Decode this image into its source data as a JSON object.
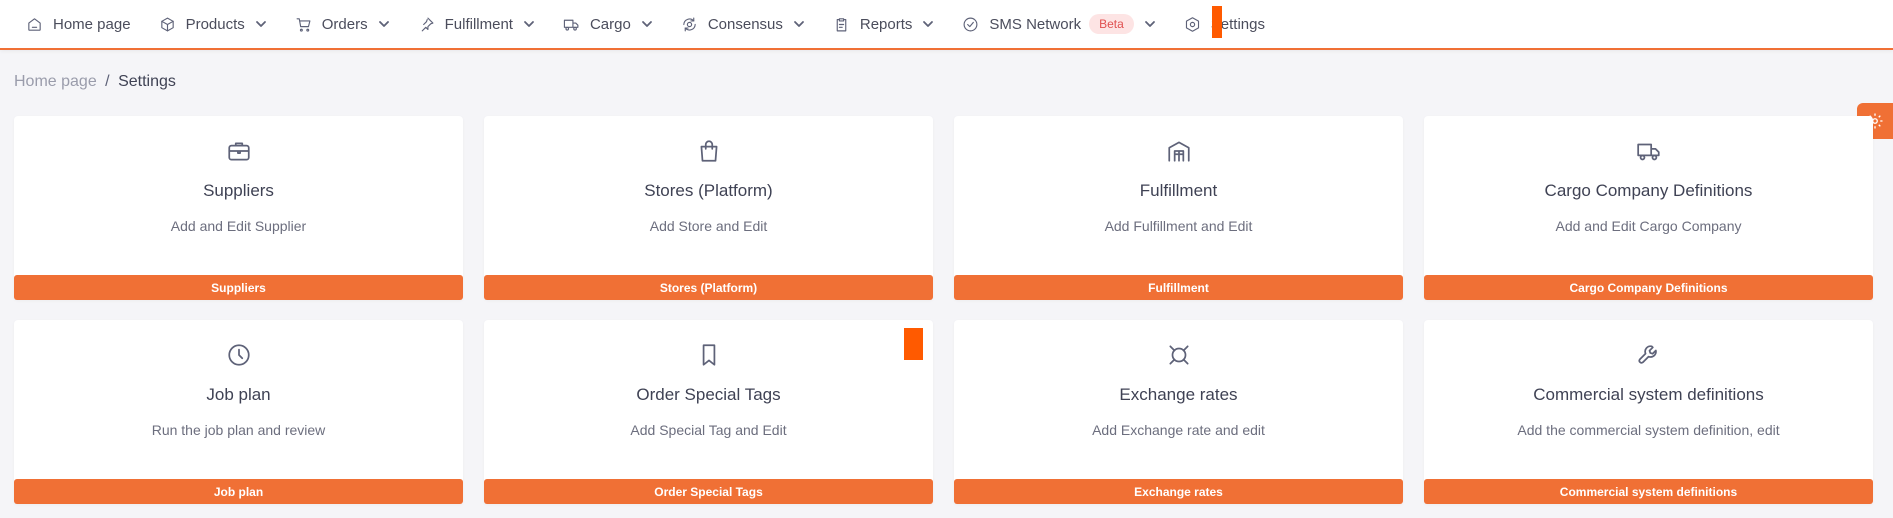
{
  "nav": {
    "items": [
      {
        "label": "Home page",
        "icon": "home-icon",
        "has_dropdown": false
      },
      {
        "label": "Products",
        "icon": "box-icon",
        "has_dropdown": true
      },
      {
        "label": "Orders",
        "icon": "cart-icon",
        "has_dropdown": true
      },
      {
        "label": "Fulfillment",
        "icon": "pin-icon",
        "has_dropdown": true
      },
      {
        "label": "Cargo",
        "icon": "truck-icon",
        "has_dropdown": true
      },
      {
        "label": "Consensus",
        "icon": "consensus-icon",
        "has_dropdown": true
      },
      {
        "label": "Reports",
        "icon": "clipboard-icon",
        "has_dropdown": true
      },
      {
        "label": "SMS Network",
        "icon": "check-circle-icon",
        "has_dropdown": true,
        "badge": "Beta"
      },
      {
        "label": "Settings",
        "icon": "hexagon-gear-icon",
        "has_dropdown": false
      }
    ]
  },
  "breadcrumb": {
    "parent": "Home page",
    "separator": "/",
    "current": "Settings"
  },
  "cards": [
    {
      "icon": "briefcase-icon",
      "title": "Suppliers",
      "description": "Add and Edit Supplier",
      "button": "Suppliers"
    },
    {
      "icon": "shopping-bag-icon",
      "title": "Stores (Platform)",
      "description": "Add Store and Edit",
      "button": "Stores (Platform)"
    },
    {
      "icon": "warehouse-icon",
      "title": "Fulfillment",
      "description": "Add Fulfillment and Edit",
      "button": "Fulfillment"
    },
    {
      "icon": "truck-icon",
      "title": "Cargo Company Definitions",
      "description": "Add and Edit Cargo Company",
      "button": "Cargo Company Definitions"
    },
    {
      "icon": "clock-icon",
      "title": "Job plan",
      "description": "Run the job plan and review",
      "button": "Job plan"
    },
    {
      "icon": "bookmark-icon",
      "title": "Order Special Tags",
      "description": "Add Special Tag and Edit",
      "button": "Order Special Tags"
    },
    {
      "icon": "currency-icon",
      "title": "Exchange rates",
      "description": "Add Exchange rate and edit",
      "button": "Exchange rates"
    },
    {
      "icon": "wrench-icon",
      "title": "Commercial system definitions",
      "description": "Add the commercial system definition, edit",
      "button": "Commercial system definitions"
    }
  ],
  "colors": {
    "accent": "#f07035",
    "marker": "#ff5a00",
    "badge_bg": "#fde4e4",
    "badge_text": "#e05050"
  }
}
